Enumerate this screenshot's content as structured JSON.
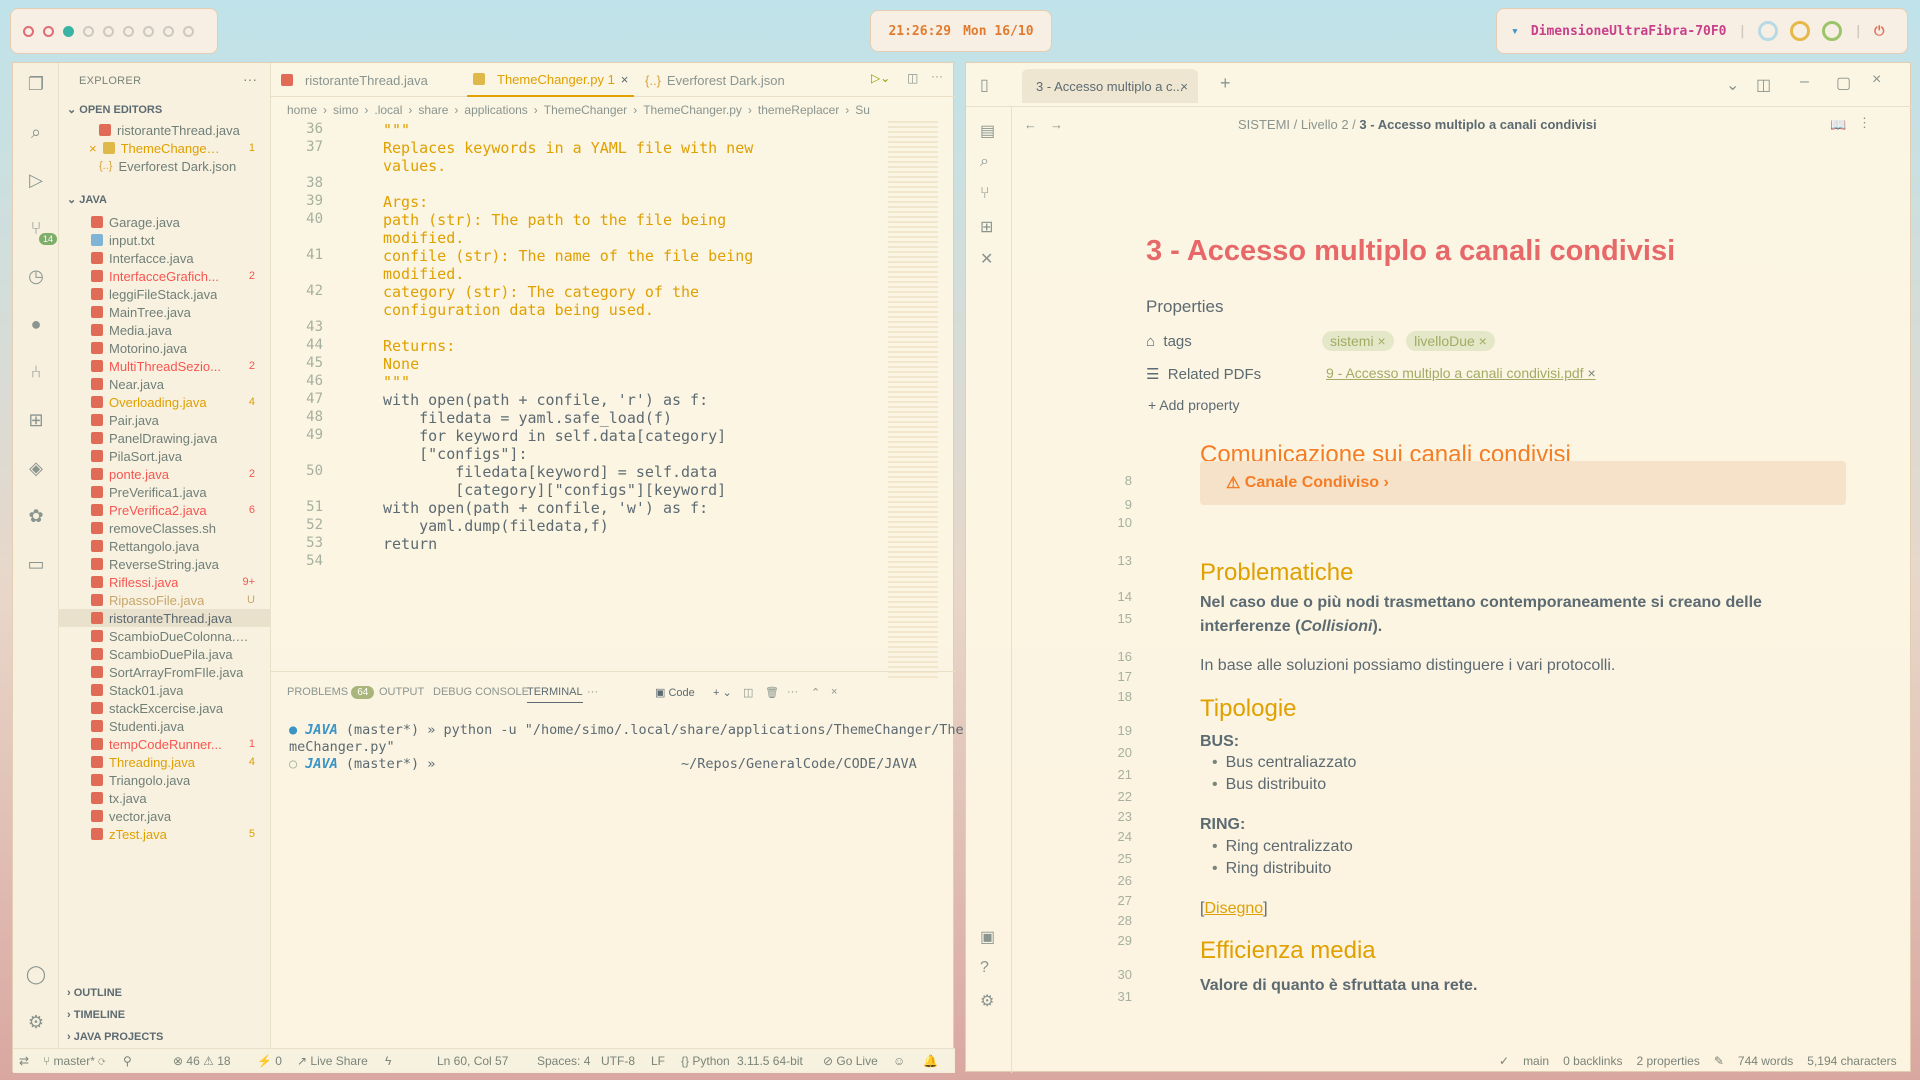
{
  "topbar": {
    "clock": "21:26:29",
    "date": "Mon 16/10",
    "network": "DimensioneUltraFibra-70F0"
  },
  "vscode": {
    "explorer_title": "EXPLORER",
    "open_editors_label": "OPEN EDITORS",
    "open_editors": [
      {
        "name": "ristoranteThread.java",
        "type": "java",
        "count": ""
      },
      {
        "name": "ThemeChanger.py",
        "type": "py",
        "count": "1"
      },
      {
        "name": "Everforest Dark.json",
        "type": "json",
        "count": ""
      }
    ],
    "java_label": "JAVA",
    "files": [
      {
        "name": "Garage.java",
        "state": "",
        "count": ""
      },
      {
        "name": "input.txt",
        "state": "txt",
        "count": ""
      },
      {
        "name": "Interfacce.java",
        "state": "",
        "count": ""
      },
      {
        "name": "InterfacceGrafich...",
        "state": "err",
        "count": "2"
      },
      {
        "name": "leggiFileStack.java",
        "state": "",
        "count": ""
      },
      {
        "name": "MainTree.java",
        "state": "",
        "count": ""
      },
      {
        "name": "Media.java",
        "state": "",
        "count": ""
      },
      {
        "name": "Motorino.java",
        "state": "",
        "count": ""
      },
      {
        "name": "MultiThreadSezio...",
        "state": "err",
        "count": "2"
      },
      {
        "name": "Near.java",
        "state": "",
        "count": ""
      },
      {
        "name": "Overloading.java",
        "state": "warn",
        "count": "4"
      },
      {
        "name": "Pair.java",
        "state": "",
        "count": ""
      },
      {
        "name": "PanelDrawing.java",
        "state": "",
        "count": ""
      },
      {
        "name": "PilaSort.java",
        "state": "",
        "count": ""
      },
      {
        "name": "ponte.java",
        "state": "err",
        "count": "2"
      },
      {
        "name": "PreVerifica1.java",
        "state": "",
        "count": ""
      },
      {
        "name": "PreVerifica2.java",
        "state": "err",
        "count": "6"
      },
      {
        "name": "removeClasses.sh",
        "state": "",
        "count": ""
      },
      {
        "name": "Rettangolo.java",
        "state": "",
        "count": ""
      },
      {
        "name": "ReverseString.java",
        "state": "",
        "count": ""
      },
      {
        "name": "Riflessi.java",
        "state": "err",
        "count": "9+"
      },
      {
        "name": "RipassoFile.java",
        "state": "untr",
        "count": "U"
      },
      {
        "name": "ristoranteThread.java",
        "state": "sel",
        "count": ""
      },
      {
        "name": "ScambioDueColonna.j...",
        "state": "",
        "count": ""
      },
      {
        "name": "ScambioDuePila.java",
        "state": "",
        "count": ""
      },
      {
        "name": "SortArrayFromFIle.java",
        "state": "",
        "count": ""
      },
      {
        "name": "Stack01.java",
        "state": "",
        "count": ""
      },
      {
        "name": "stackExcercise.java",
        "state": "",
        "count": ""
      },
      {
        "name": "Studenti.java",
        "state": "",
        "count": ""
      },
      {
        "name": "tempCodeRunner...",
        "state": "err",
        "count": "1"
      },
      {
        "name": "Threading.java",
        "state": "warn",
        "count": "4"
      },
      {
        "name": "Triangolo.java",
        "state": "",
        "count": ""
      },
      {
        "name": "tx.java",
        "state": "",
        "count": ""
      },
      {
        "name": "vector.java",
        "state": "",
        "count": ""
      },
      {
        "name": "zTest.java",
        "state": "warn",
        "count": "5"
      }
    ],
    "bottom_sections": [
      "OUTLINE",
      "TIMELINE",
      "JAVA PROJECTS"
    ],
    "tabs": [
      {
        "label": "ristoranteThread.java"
      },
      {
        "label": "ThemeChanger.py 1"
      },
      {
        "label": "Everforest Dark.json"
      }
    ],
    "breadcrumb": [
      "home",
      "simo",
      ".local",
      "share",
      "applications",
      "ThemeChanger",
      "ThemeChanger.py",
      "themeReplacer",
      "Su"
    ],
    "code_lines": [
      {
        "n": "36",
        "t": "\"\"\""
      },
      {
        "n": "37",
        "t": "Replaces keywords in a YAML file with new"
      },
      {
        "n": "",
        "t": "values."
      },
      {
        "n": "38",
        "t": ""
      },
      {
        "n": "39",
        "t": "Args:"
      },
      {
        "n": "40",
        "t": "path (str): The path to the file being"
      },
      {
        "n": "",
        "t": "modified."
      },
      {
        "n": "41",
        "t": "confile (str): The name of the file being"
      },
      {
        "n": "",
        "t": "modified."
      },
      {
        "n": "42",
        "t": "category (str): The category of the"
      },
      {
        "n": "",
        "t": "configuration data being used."
      },
      {
        "n": "43",
        "t": ""
      },
      {
        "n": "44",
        "t": "Returns:"
      },
      {
        "n": "45",
        "t": "None"
      },
      {
        "n": "46",
        "t": "\"\"\""
      },
      {
        "n": "47",
        "t": "with open(path + confile, 'r') as f:"
      },
      {
        "n": "48",
        "t": "    filedata = yaml.safe_load(f)"
      },
      {
        "n": "49",
        "t": "    for keyword in self.data[category]"
      },
      {
        "n": "",
        "t": "    [\"configs\"]:"
      },
      {
        "n": "50",
        "t": "        filedata[keyword] = self.data"
      },
      {
        "n": "",
        "t": "        [category][\"configs\"][keyword]"
      },
      {
        "n": "51",
        "t": "with open(path + confile, 'w') as f:"
      },
      {
        "n": "52",
        "t": "    yaml.dump(filedata,f)"
      },
      {
        "n": "53",
        "t": "return"
      },
      {
        "n": "54",
        "t": ""
      }
    ],
    "panel": {
      "problems": "PROBLEMS",
      "problems_count": "64",
      "output": "OUTPUT",
      "debug": "DEBUG CONSOLE",
      "terminal": "TERMINAL",
      "code_label": "Code",
      "term_line1a": "JAVA",
      "term_line1b": " (master*) » python -u \"/home/simo/.local/share/applications/ThemeChanger/The",
      "term_line2": "meChanger.py\"",
      "term_line3a": "JAVA",
      "term_line3b": " (master*) »",
      "term_cwd": "~/Repos/GeneralCode/CODE/JAVA"
    },
    "status": {
      "branch": "master*",
      "errors": "46",
      "warnings": "18",
      "ports": "0",
      "liveshare": "Live Share",
      "position": "Ln 60, Col 57",
      "spaces": "Spaces: 4",
      "encoding": "UTF-8",
      "eol": "LF",
      "language": "Python",
      "version": "3.11.5 64-bit",
      "golive": "Go Live"
    }
  },
  "obsidian": {
    "tab_title": "3 - Accesso multiplo a c...",
    "breadcrumb_1": "SISTEMI",
    "breadcrumb_2": "Livello 2",
    "breadcrumb_3": "3 - Accesso multiplo a canali condivisi",
    "title": "3 - Accesso multiplo a canali condivisi",
    "properties_label": "Properties",
    "tags_label": "tags",
    "tags": [
      "sistemi",
      "livelloDue"
    ],
    "related_label": "Related PDFs",
    "related_value": "9 - Accesso multiplo a canali condivisi.pdf",
    "add_property": "Add property",
    "h_comunicazione": "Comunicazione sui canali condivisi",
    "callout": "Canale Condiviso",
    "h_problematiche": "Problematiche",
    "p_nel_caso_1": "Nel caso due o più nodi trasmettano contemporaneamente si creano delle",
    "p_nel_caso_2a": "interferenze (",
    "p_nel_caso_2b": "Collisioni",
    "p_nel_caso_2c": ").",
    "p_in_base": "In base alle soluzioni possiamo distinguere i vari protocolli.",
    "h_tipologie": "Tipologie",
    "bus_label": "BUS:",
    "bus_items": [
      "Bus centraliazzato",
      "Bus distribuito"
    ],
    "ring_label": "RING:",
    "ring_items": [
      "Ring centralizzato",
      "Ring distribuito"
    ],
    "disegno_open": "[",
    "disegno": "Disegno",
    "disegno_close": "]",
    "h_efficienza": "Efficienza media",
    "p_valore": "Valore di quanto è sfruttata una rete.",
    "line_numbers": [
      "8",
      "9",
      "10",
      "13",
      "14",
      "15",
      "16",
      "17",
      "18",
      "19",
      "20",
      "21",
      "22",
      "23",
      "24",
      "25",
      "26",
      "27",
      "28",
      "29",
      "30",
      "31"
    ],
    "status": {
      "branch": "main",
      "backlinks": "0 backlinks",
      "properties": "2 properties",
      "words": "744 words",
      "chars": "5,194 characters"
    }
  }
}
